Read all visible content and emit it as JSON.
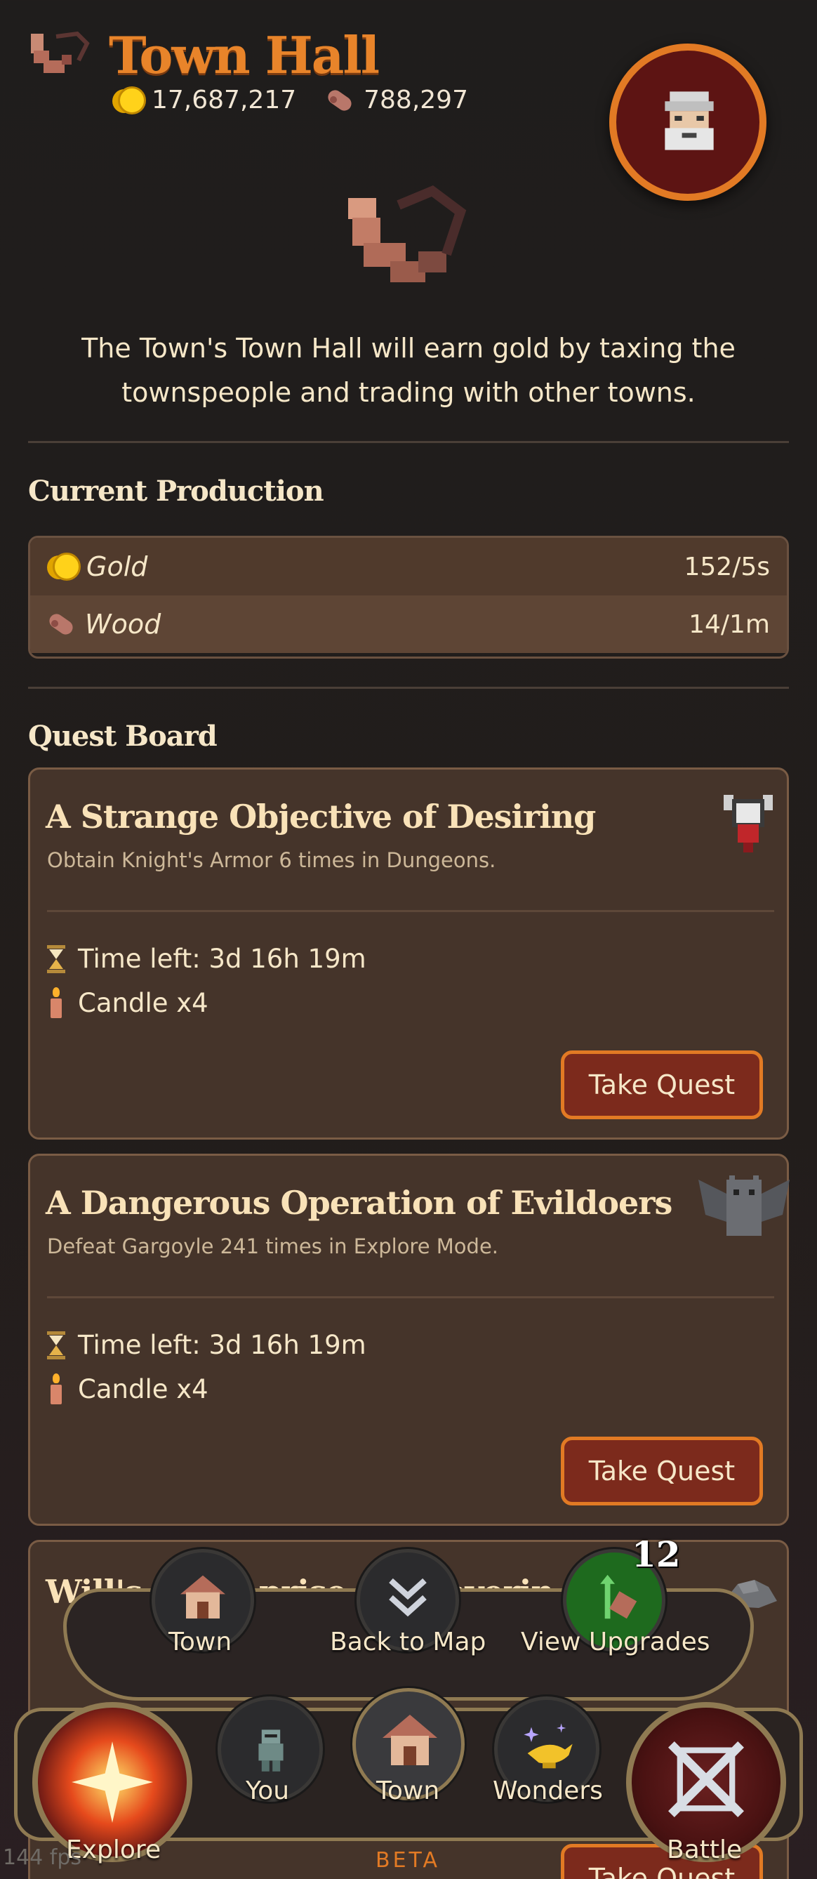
{
  "header": {
    "title": "Town Hall",
    "gold": "17,687,217",
    "wood": "788,297"
  },
  "description": "The Town's Town Hall will earn gold by taxing the townspeople and trading with other towns.",
  "production": {
    "title": "Current Production",
    "rows": [
      {
        "icon": "gold-coin-icon",
        "label": "Gold",
        "value": "152/5s"
      },
      {
        "icon": "wood-log-icon",
        "label": "Wood",
        "value": "14/1m"
      }
    ]
  },
  "quest_board": {
    "title": "Quest Board",
    "quests": [
      {
        "title": "A Strange Objective of Desiring",
        "subtitle": "Obtain Knight's Armor 6 times in Dungeons.",
        "time_left": "Time left: 3d 16h 19m",
        "reward": "Candle x4",
        "button": "Take Quest",
        "icon": "knight-armor-icon"
      },
      {
        "title": "A Dangerous Operation of Evildoers",
        "subtitle": "Defeat Gargoyle 241 times in Explore Mode.",
        "time_left": "Time left: 3d 16h 19m",
        "reward": "Candle x4",
        "button": "Take Quest",
        "icon": "gargoyle-icon"
      },
      {
        "title_left": "Will's E",
        "title_mid": "prise o",
        "title_right": "overin",
        "button": "Take Quest",
        "icon": "rock-icon"
      }
    ]
  },
  "nav": {
    "upper": [
      {
        "label": "Town",
        "icon": "house-icon"
      },
      {
        "label": "Back to Map",
        "icon": "chevron-down-double-icon"
      },
      {
        "label": "View Upgrades",
        "icon": "upgrade-arrow-icon",
        "badge": "12"
      }
    ],
    "lower": [
      {
        "label": "Explore",
        "icon": "explosion-icon"
      },
      {
        "label": "You",
        "icon": "armored-hero-icon"
      },
      {
        "label": "Town",
        "icon": "house-icon"
      },
      {
        "label": "Wonders",
        "icon": "magic-lamp-icon"
      },
      {
        "label": "Battle",
        "icon": "crossed-swords-icon"
      }
    ],
    "beta": "BETA"
  },
  "fps": "144 fps",
  "colors": {
    "accent_orange": "#e27a24",
    "button_red": "#7c2a1c",
    "card_bg": "#45342a",
    "text_cream": "#f6e7c8"
  }
}
